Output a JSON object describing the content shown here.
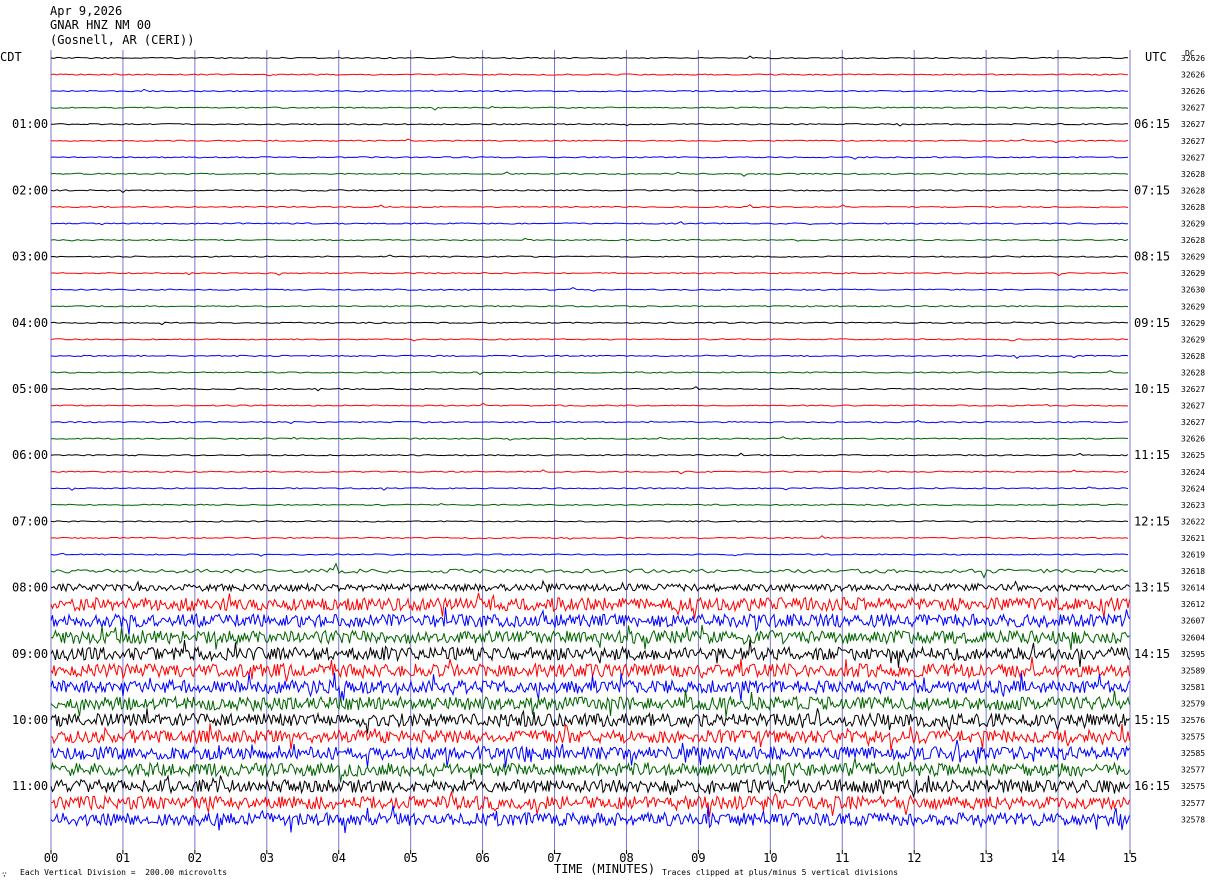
{
  "header": {
    "date": "Apr 9,2026",
    "station": "GNAR HNZ NM 00",
    "location": "(Gosnell, AR (CERI))"
  },
  "left_tz": "CDT",
  "right_tz": "UTC",
  "dc_label": "DC",
  "footer": {
    "division_note": "Each Vertical Division =  200.00 microvolts",
    "xlabel": "TIME (MINUTES)",
    "clip_note": "Traces clipped at plus/minus 5 vertical divisions",
    "corner_mark": "∵"
  },
  "chart_data": {
    "type": "line",
    "subtype": "helicorder",
    "xlim": [
      0,
      15
    ],
    "x_tick_labels": [
      "00",
      "01",
      "02",
      "03",
      "04",
      "05",
      "06",
      "07",
      "08",
      "09",
      "10",
      "11",
      "12",
      "13",
      "14",
      "15"
    ],
    "trace_colors": [
      "#000000",
      "#ff0000",
      "#0000ff",
      "#006400"
    ],
    "grid_color": "#7777cc",
    "left_hour_labels": [
      "01:00",
      "02:00",
      "03:00",
      "04:00",
      "05:00",
      "06:00",
      "07:00",
      "08:00",
      "09:00",
      "10:00",
      "11:00"
    ],
    "right_hour_labels": [
      "06:15",
      "07:15",
      "08:15",
      "09:15",
      "10:15",
      "11:15",
      "12:15",
      "13:15",
      "14:15",
      "15:15",
      "16:15"
    ],
    "dc_offsets": [
      "32626",
      "32626",
      "32626",
      "32627",
      "32627",
      "32627",
      "32627",
      "32628",
      "32628",
      "32628",
      "32629",
      "32628",
      "32629",
      "32629",
      "32630",
      "32629",
      "32629",
      "32629",
      "32628",
      "32628",
      "32627",
      "32627",
      "32627",
      "32626",
      "32625",
      "32624",
      "32624",
      "32623",
      "32622",
      "32621",
      "32619",
      "32618",
      "32614",
      "32612",
      "32607",
      "32604",
      "32595",
      "32589",
      "32581",
      "32579",
      "32576",
      "32575",
      "32585",
      "32577",
      "32575",
      "32577",
      "32578"
    ]
  }
}
